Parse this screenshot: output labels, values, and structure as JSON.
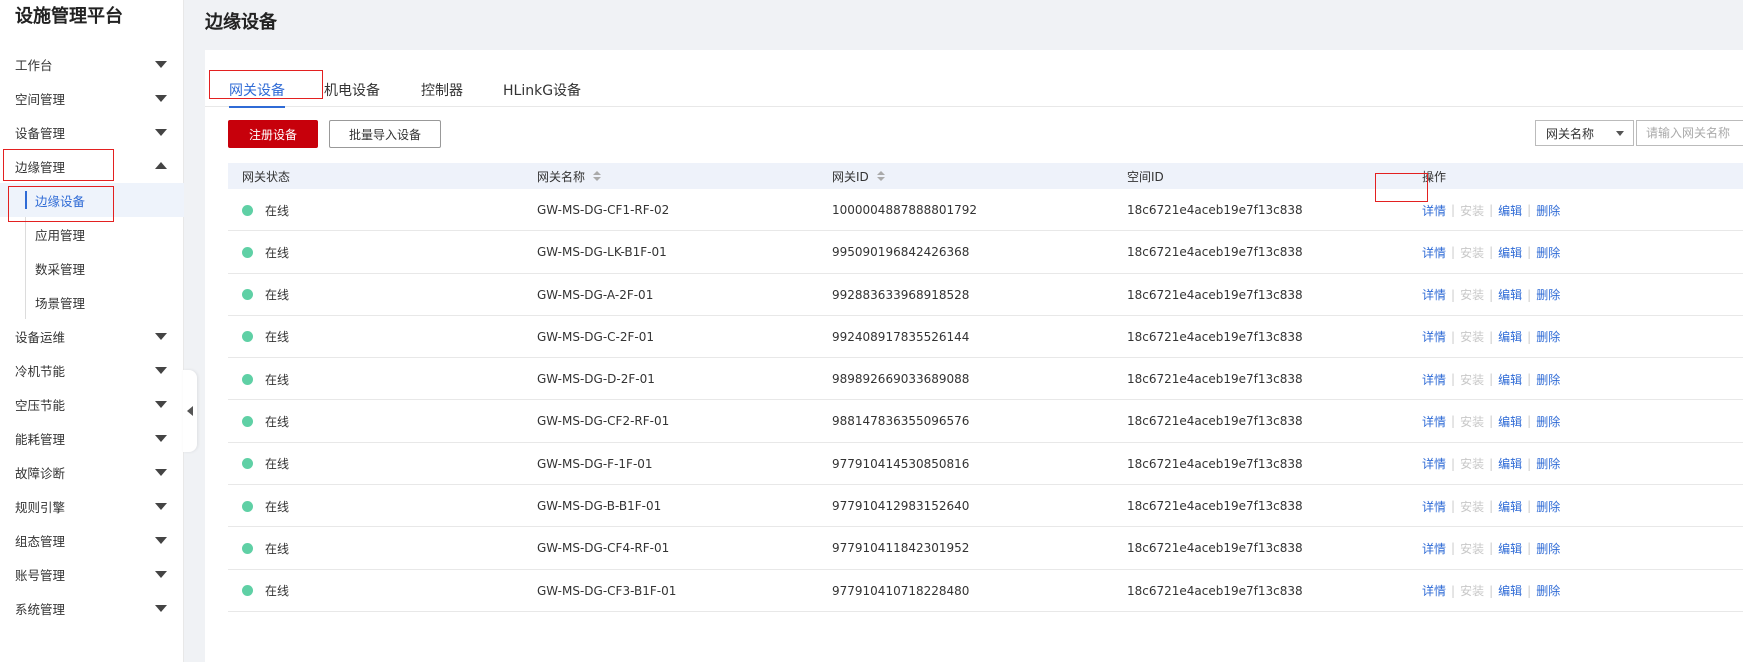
{
  "app": {
    "title": "设施管理平台"
  },
  "sidebar": {
    "items": [
      {
        "label": "工作台"
      },
      {
        "label": "空间管理"
      },
      {
        "label": "设备管理"
      },
      {
        "label": "边缘管理",
        "expanded": true,
        "children": [
          {
            "label": "边缘设备",
            "active": true
          },
          {
            "label": "应用管理"
          },
          {
            "label": "数采管理"
          },
          {
            "label": "场景管理"
          }
        ]
      },
      {
        "label": "设备运维"
      },
      {
        "label": "冷机节能"
      },
      {
        "label": "空压节能"
      },
      {
        "label": "能耗管理"
      },
      {
        "label": "故障诊断"
      },
      {
        "label": "规则引擎"
      },
      {
        "label": "组态管理"
      },
      {
        "label": "账号管理"
      },
      {
        "label": "系统管理"
      }
    ]
  },
  "page": {
    "title": "边缘设备"
  },
  "tabs": [
    {
      "label": "网关设备",
      "active": true
    },
    {
      "label": "机电设备"
    },
    {
      "label": "控制器"
    },
    {
      "label": "HLinkG设备"
    }
  ],
  "toolbar": {
    "register_label": "注册设备",
    "import_label": "批量导入设备",
    "filter_select": "网关名称",
    "search_placeholder": "请输入网关名称"
  },
  "table": {
    "columns": [
      "网关状态",
      "网关名称",
      "网关ID",
      "空间ID",
      "操作"
    ],
    "actions": [
      "详情",
      "安装",
      "编辑",
      "删除"
    ],
    "rows": [
      {
        "status": "在线",
        "name": "GW-MS-DG-CF1-RF-02",
        "id": "1000004887888801792",
        "space_id": "18c6721e4aceb19e7f13c838"
      },
      {
        "status": "在线",
        "name": "GW-MS-DG-LK-B1F-01",
        "id": "995090196842426368",
        "space_id": "18c6721e4aceb19e7f13c838"
      },
      {
        "status": "在线",
        "name": "GW-MS-DG-A-2F-01",
        "id": "992883633968918528",
        "space_id": "18c6721e4aceb19e7f13c838"
      },
      {
        "status": "在线",
        "name": "GW-MS-DG-C-2F-01",
        "id": "992408917835526144",
        "space_id": "18c6721e4aceb19e7f13c838"
      },
      {
        "status": "在线",
        "name": "GW-MS-DG-D-2F-01",
        "id": "989892669033689088",
        "space_id": "18c6721e4aceb19e7f13c838"
      },
      {
        "status": "在线",
        "name": "GW-MS-DG-CF2-RF-01",
        "id": "988147836355096576",
        "space_id": "18c6721e4aceb19e7f13c838"
      },
      {
        "status": "在线",
        "name": "GW-MS-DG-F-1F-01",
        "id": "977910414530850816",
        "space_id": "18c6721e4aceb19e7f13c838"
      },
      {
        "status": "在线",
        "name": "GW-MS-DG-B-B1F-01",
        "id": "977910412983152640",
        "space_id": "18c6721e4aceb19e7f13c838"
      },
      {
        "status": "在线",
        "name": "GW-MS-DG-CF4-RF-01",
        "id": "977910411842301952",
        "space_id": "18c6721e4aceb19e7f13c838"
      },
      {
        "status": "在线",
        "name": "GW-MS-DG-CF3-B1F-01",
        "id": "977910410718228480",
        "space_id": "18c6721e4aceb19e7f13c838"
      }
    ]
  },
  "colors": {
    "accent": "#2f6bd6",
    "primary_button": "#c7000b",
    "online": "#5fd0a5",
    "highlight": "#e32020"
  }
}
